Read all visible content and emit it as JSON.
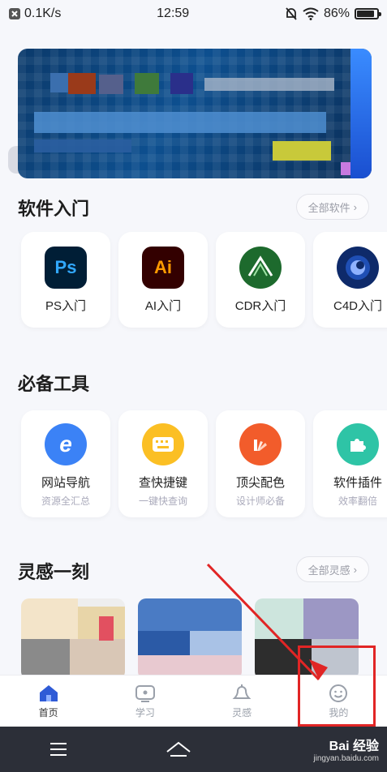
{
  "status_bar": {
    "network_speed": "0.1K/s",
    "time": "12:59",
    "battery": "86%",
    "battery_level": 0.86
  },
  "sections": {
    "software": {
      "title": "软件入门",
      "more": "全部软件"
    },
    "tools": {
      "title": "必备工具"
    },
    "inspiration": {
      "title": "灵感一刻",
      "more": "全部灵感"
    }
  },
  "software_cards": [
    {
      "label": "PS入门",
      "icon_text": "Ps",
      "icon": "photoshop-icon",
      "bg": "#001e36",
      "fg": "#31a8ff"
    },
    {
      "label": "AI入门",
      "icon_text": "Ai",
      "icon": "illustrator-icon",
      "bg": "#330000",
      "fg": "#ff9a00"
    },
    {
      "label": "CDR入门",
      "icon_text": "",
      "icon": "coreldraw-icon",
      "bg": "#1d6a2d",
      "fg": "#ffffff"
    },
    {
      "label": "C4D入门",
      "icon_text": "",
      "icon": "cinema4d-icon",
      "bg": "#0e2a6a",
      "fg": "#ffffff"
    }
  ],
  "tool_cards": [
    {
      "label": "网站导航",
      "sub": "资源全汇总",
      "icon": "browser-icon",
      "bg": "#3b82f6"
    },
    {
      "label": "查快捷键",
      "sub": "一键快查询",
      "icon": "keyboard-icon",
      "bg": "#fbbf24"
    },
    {
      "label": "顶尖配色",
      "sub": "设计师必备",
      "icon": "palette-icon",
      "bg": "#f25c2b"
    },
    {
      "label": "软件插件",
      "sub": "效率翻倍",
      "icon": "puzzle-icon",
      "bg": "#2ec4a6"
    }
  ],
  "tabs": [
    {
      "label": "首页",
      "icon": "home-icon",
      "active": true
    },
    {
      "label": "学习",
      "icon": "study-icon",
      "active": false
    },
    {
      "label": "灵感",
      "icon": "bell-icon",
      "active": false
    },
    {
      "label": "我的",
      "icon": "smiley-icon",
      "active": false
    }
  ],
  "watermark": {
    "brand": "Bai 经验",
    "url": "jingyan.baidu.com"
  }
}
